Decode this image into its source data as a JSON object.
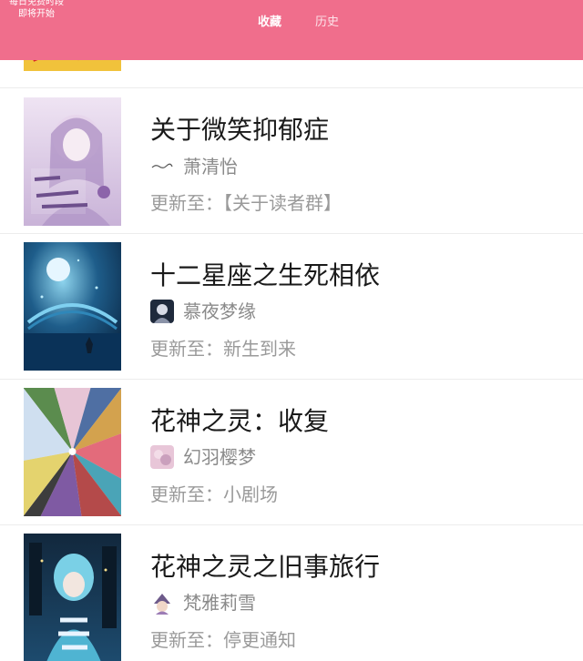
{
  "header": {
    "promo_line1": "每日免费时段",
    "promo_line2": "即将开始",
    "tabs": [
      {
        "label": "收藏",
        "active": true
      },
      {
        "label": "历史",
        "active": false
      }
    ],
    "background_color": "#f06e8c"
  },
  "books": [
    {
      "title": "关于微笑抑郁症",
      "author": "萧清怡",
      "update": "更新至：【关于读者群】",
      "cover_icon": "anime-girl-purple-cover"
    },
    {
      "title": "十二星座之生死相依",
      "author": "慕夜梦缘",
      "update": "更新至：新生到来",
      "cover_icon": "night-bridge-moon-cover"
    },
    {
      "title": "花神之灵：收复",
      "author": "幻羽樱梦",
      "update": "更新至：小剧场",
      "cover_icon": "colorful-fan-cover"
    },
    {
      "title": "花神之灵之旧事旅行",
      "author": "梵雅莉雪",
      "update": "更新至：停更通知",
      "cover_icon": "blue-hair-girl-cover"
    }
  ]
}
